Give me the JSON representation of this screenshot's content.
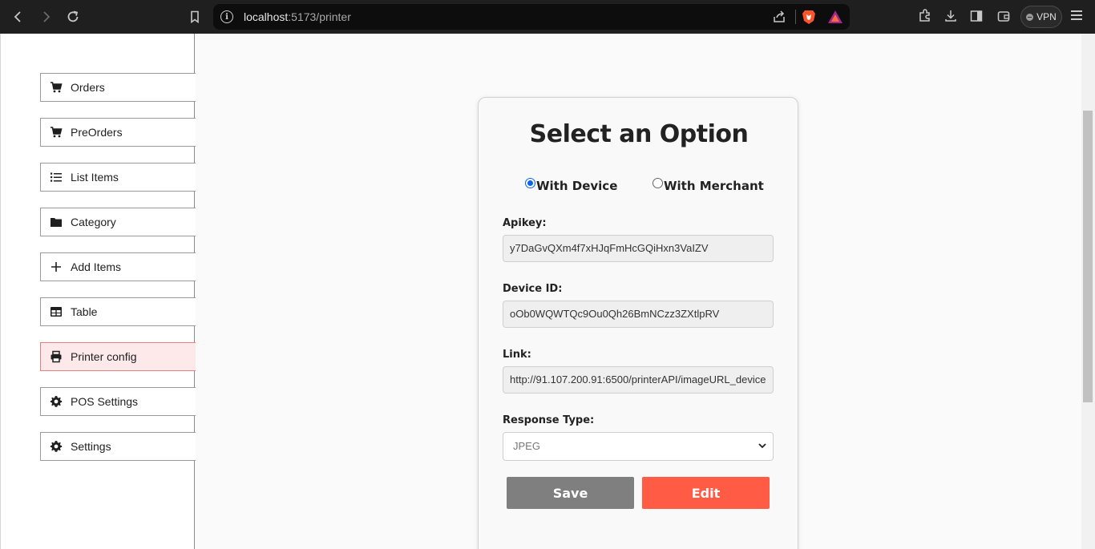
{
  "browser": {
    "url_host": "localhost",
    "url_path": ":5173/printer",
    "vpn_label": "VPN"
  },
  "sidebar": {
    "items": [
      {
        "label": "Orders",
        "icon": "cart-icon"
      },
      {
        "label": "PreOrders",
        "icon": "cart-icon"
      },
      {
        "label": "List Items",
        "icon": "list-icon"
      },
      {
        "label": "Category",
        "icon": "folder-icon"
      },
      {
        "label": "Add Items",
        "icon": "plus-icon"
      },
      {
        "label": "Table",
        "icon": "table-icon"
      },
      {
        "label": "Printer config",
        "icon": "printer-icon",
        "active": true
      },
      {
        "label": "POS Settings",
        "icon": "gear-icon"
      },
      {
        "label": "Settings",
        "icon": "gear-icon"
      }
    ]
  },
  "card": {
    "title": "Select an Option",
    "radio_device": "With Device",
    "radio_merchant": "With Merchant",
    "selected": "With Device",
    "apikey_label": "Apikey:",
    "apikey_value": "y7DaGvQXm4f7xHJqFmHcGQiHxn3VaIZV",
    "device_label": "Device ID:",
    "device_value": "oOb0WQWTQc9Ou0Qh26BmNCzz3ZXtlpRV",
    "link_label": "Link:",
    "link_value": "http://91.107.200.91:6500/printerAPI/imageURL_device",
    "response_label": "Response Type:",
    "response_value": "JPEG",
    "save_label": "Save",
    "edit_label": "Edit"
  },
  "colors": {
    "accent": "#ff5b45",
    "active_bg": "#fde9e9",
    "save_bg": "#7f7f7f"
  }
}
